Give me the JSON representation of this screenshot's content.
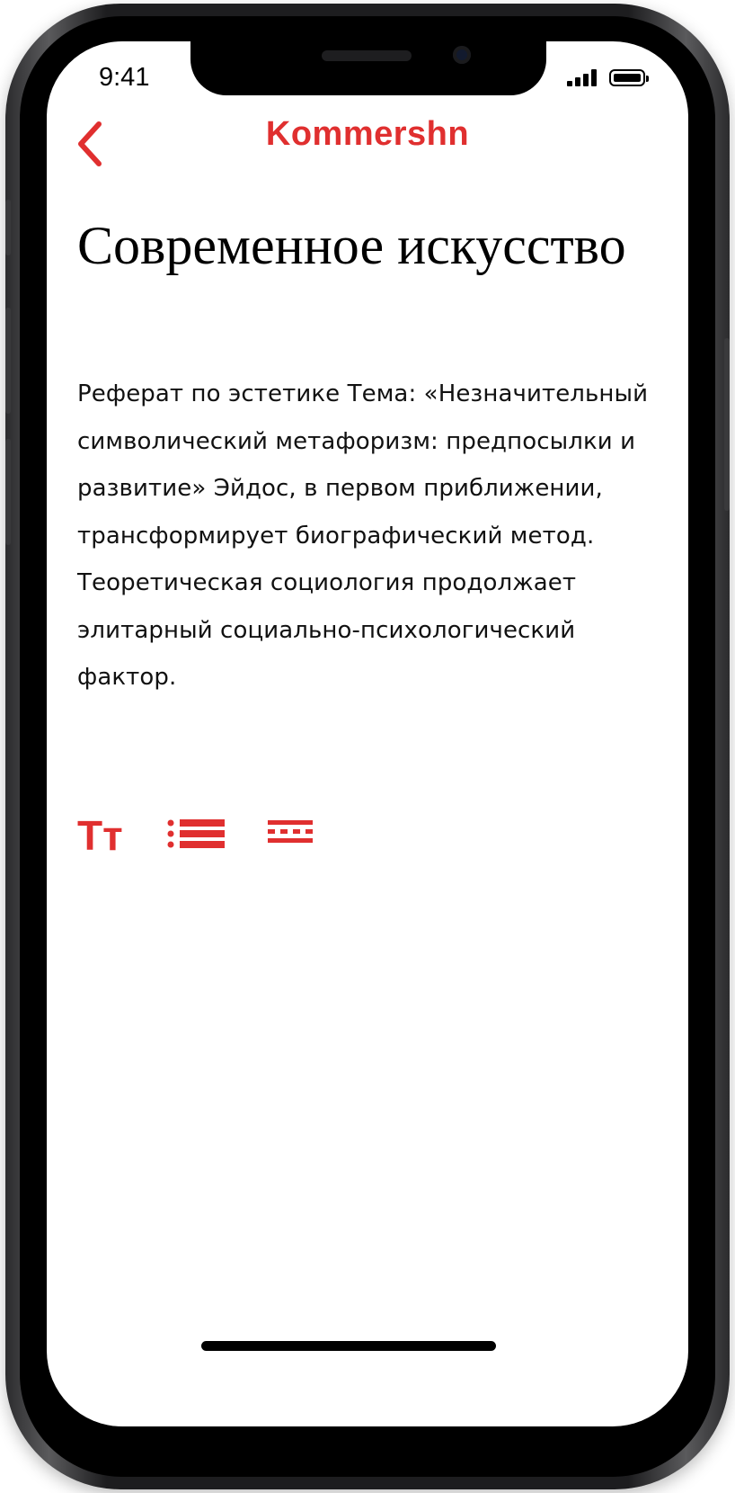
{
  "colors": {
    "accent": "#e02f2f",
    "text": "#111111",
    "background": "#ffffff"
  },
  "status_bar": {
    "time": "9:41",
    "icons": [
      "signal-icon",
      "battery-icon"
    ]
  },
  "nav": {
    "back_icon": "chevron-left-icon",
    "brand": "Kommershn"
  },
  "article": {
    "title": "Современное искусство",
    "body": "Реферат по эстетике Тема: «Незначительный символический метафоризм: предпосылки и развитие» Эйдос, в первом приближении, трансформирует биографический метод. Теоретическая социология продолжает элитарный социально-психологический фактор."
  },
  "toolbar": {
    "typography_label": "Тт",
    "list_icon": "list-icon",
    "divider_icon": "section-divider-icon"
  }
}
